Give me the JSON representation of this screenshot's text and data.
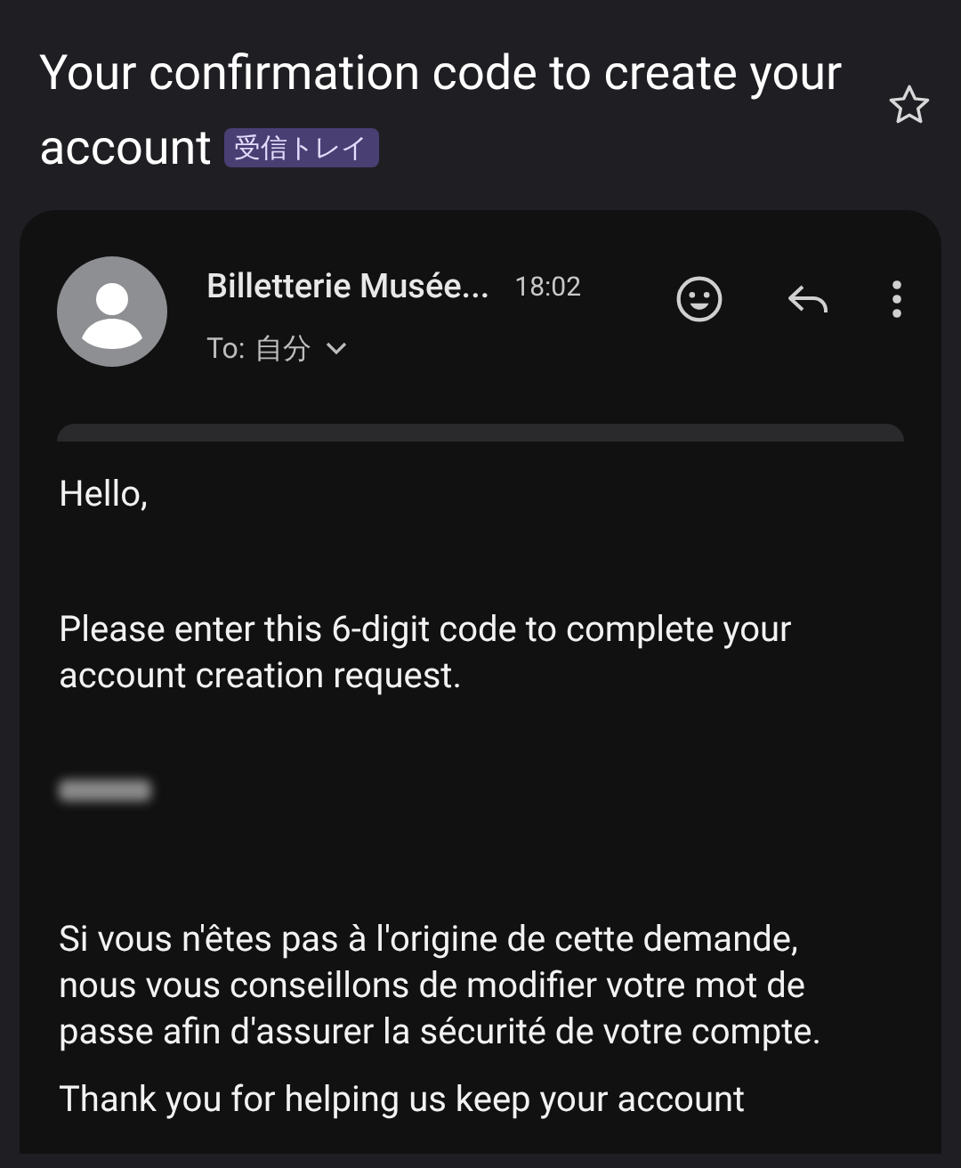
{
  "subject": {
    "title": "Your confirmation code to create your account",
    "label": "受信トレイ",
    "starred": false
  },
  "message": {
    "sender": "Billetterie Musée...",
    "time": "18:02",
    "to_label": "To:",
    "recipient": "自分"
  },
  "body": [
    {
      "kind": "text",
      "text": "Hello,"
    },
    {
      "kind": "text",
      "text": "Please enter this 6-digit code to complete your account creation request."
    },
    {
      "kind": "redacted"
    },
    {
      "kind": "text",
      "text": "Si vous n'êtes pas à l'origine de cette demande, nous vous conseillons de modifier votre mot de passe afin d'assurer la sécurité de votre compte."
    },
    {
      "kind": "text",
      "text": "Thank you for helping us keep your account"
    }
  ]
}
